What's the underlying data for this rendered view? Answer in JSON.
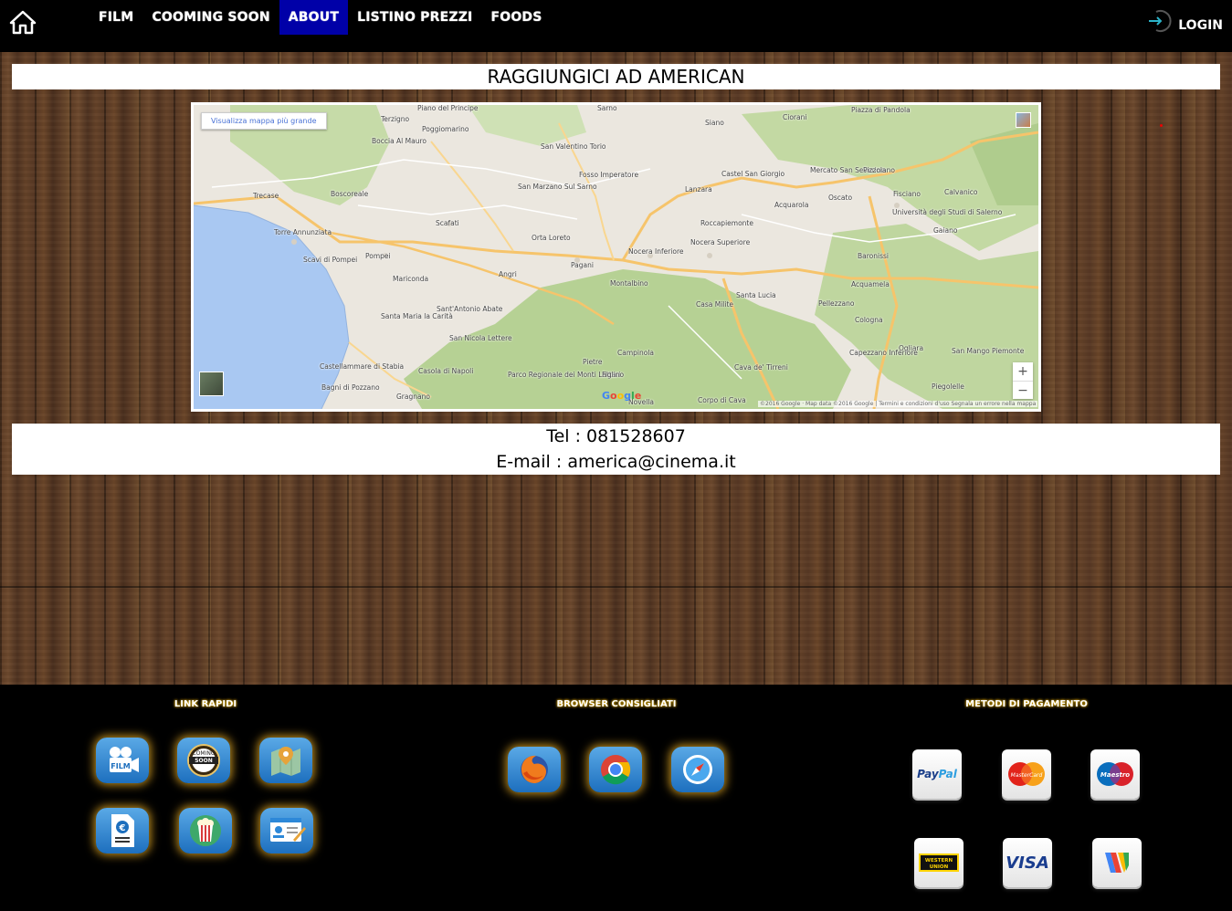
{
  "nav": {
    "items": [
      {
        "label": "FILM",
        "active": false
      },
      {
        "label": "COOMING SOON",
        "active": false
      },
      {
        "label": "ABOUT",
        "active": true
      },
      {
        "label": "LISTINO PREZZI",
        "active": false
      },
      {
        "label": "FOODS",
        "active": false
      }
    ],
    "login_label": "LOGIN",
    "active_color": "#0000a8"
  },
  "page": {
    "title": "RAGGIUNGICI AD AMERICAN",
    "tel": "Tel : 081528607",
    "email": "E-mail : america@cinema.it"
  },
  "map": {
    "view_larger_label": "Visualizza mappa più grande",
    "attribution": "©2016 Google · Map data ©2016 Google | Termini e condizioni d'uso   Segnala un errore nella mappa",
    "zoom_in": "+",
    "zoom_out": "−",
    "places": [
      "Terzigno",
      "Piano del Principe",
      "Poggiomarino",
      "Boccia Al Mauro",
      "San Valentino Torio",
      "Sarno",
      "Siano",
      "Ciorani",
      "Piazza di Pandola",
      "Fosso Imperatore",
      "Castel San Giorgio",
      "Mercato San Severino",
      "Pizzolano",
      "Trecase",
      "Boscoreale",
      "San Marzano Sul Sarno",
      "Lanzara",
      "Acquarola",
      "Oscato",
      "Fisciano",
      "Calvanico",
      "Scafati",
      "Torre Annunziata",
      "Orta Loreto",
      "Roccapiemonte",
      "Università degli Studi di Salerno",
      "Gaiano",
      "Pompei",
      "Scavi di Pompei",
      "Nocera Inferiore",
      "Nocera Superiore",
      "Baronissi",
      "Mariconda",
      "Angri",
      "Pagani",
      "Montalbino",
      "Acquamela",
      "Sant'Antonio Abate",
      "Santa Lucia",
      "Casa Milite",
      "Pellezzano",
      "Santa Maria la Carità",
      "Cologna",
      "San Nicola Lettere",
      "Campinola",
      "Ogliara",
      "Castellammare di Stabia",
      "Pietre",
      "Capezzano Inferiore",
      "San Mango Piemonte",
      "Casola di Napoli",
      "Parco Regionale dei Monti Lattari",
      "Figlino",
      "Cava de' Tirreni",
      "Bagni di Pozzano",
      "Gragnano",
      "Novella",
      "Corpo di Cava",
      "Piegolelle"
    ]
  },
  "footer": {
    "link_rapidi_title": "LINK RAPIDI",
    "browser_title": "BROWSER CONSIGLIATI",
    "payment_title": "METODI DI PAGAMENTO",
    "quick_links": [
      {
        "icon": "film-camera-icon",
        "text": "FILM"
      },
      {
        "icon": "coming-soon-icon",
        "text": "COMING SOON"
      },
      {
        "icon": "map-pin-icon",
        "text": ""
      },
      {
        "icon": "price-list-icon",
        "text": "€"
      },
      {
        "icon": "popcorn-icon",
        "text": ""
      },
      {
        "icon": "contact-card-icon",
        "text": ""
      }
    ],
    "browsers": [
      {
        "icon": "firefox-icon"
      },
      {
        "icon": "chrome-icon"
      },
      {
        "icon": "safari-icon"
      }
    ],
    "payments": [
      {
        "icon": "paypal-icon",
        "text": "PayPal"
      },
      {
        "icon": "mastercard-icon",
        "text": "MasterCard"
      },
      {
        "icon": "maestro-icon",
        "text": "Maestro"
      },
      {
        "icon": "western-union-icon",
        "text": "WESTERN UNION"
      },
      {
        "icon": "visa-icon",
        "text": "VISA"
      },
      {
        "icon": "google-wallet-icon",
        "text": ""
      }
    ]
  }
}
